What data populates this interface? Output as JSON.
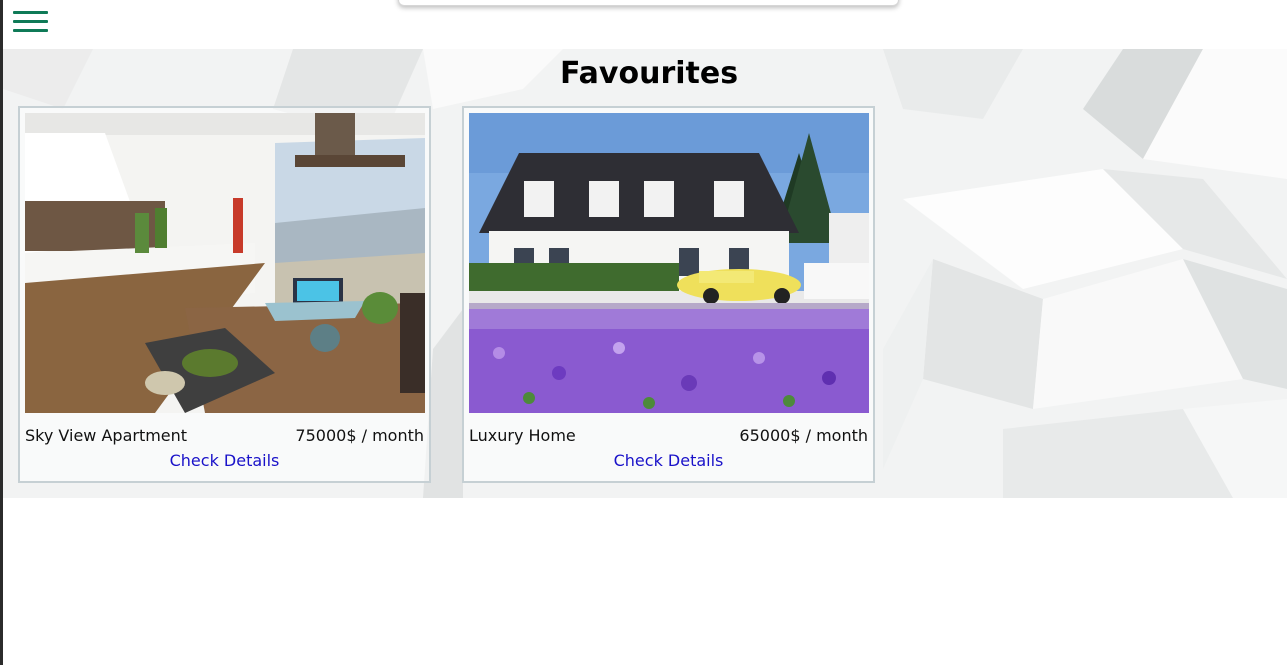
{
  "nav": {
    "menu_icon": "hamburger-menu-icon",
    "accent": "#0f7a57"
  },
  "page": {
    "title": "Favourites"
  },
  "listings": [
    {
      "name": "Sky View Apartment",
      "price": "75000$ / month",
      "link": "Check Details"
    },
    {
      "name": "Luxury Home",
      "price": "65000$ / month",
      "link": "Check Details"
    }
  ],
  "colors": {
    "link": "#1a12c9",
    "card_border": "#c6d0d4"
  }
}
